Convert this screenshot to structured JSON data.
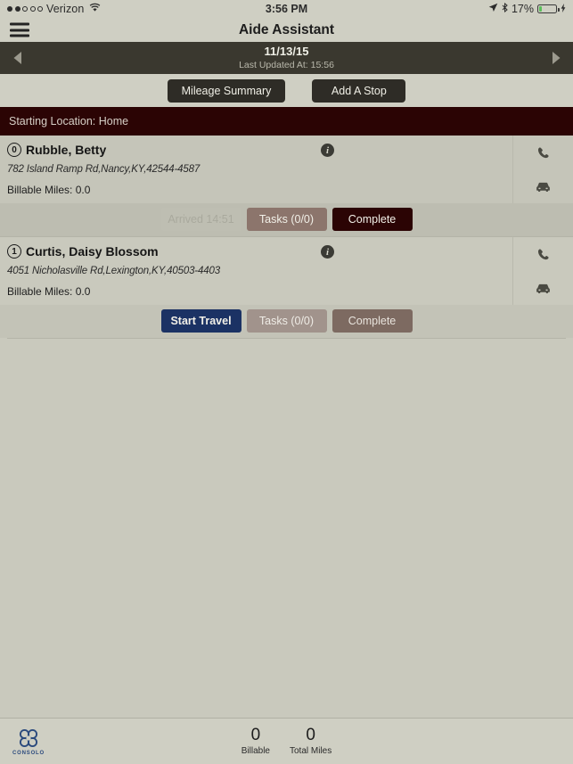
{
  "status_bar": {
    "carrier": "Verizon",
    "signal_filled": 2,
    "signal_total": 5,
    "wifi_icon": "wifi-icon",
    "time": "3:56 PM",
    "location_icon": "location-arrow-icon",
    "bluetooth_icon": "bluetooth-icon",
    "battery_percent": "17%",
    "battery_level": 17,
    "charging": true
  },
  "titlebar": {
    "menu_icon": "hamburger-menu-icon",
    "title": "Aide Assistant"
  },
  "datebar": {
    "prev_icon": "chevron-left-icon",
    "next_icon": "chevron-right-icon",
    "date": "11/13/15",
    "last_updated": "Last Updated At: 15:56"
  },
  "actions": {
    "mileage_summary": "Mileage Summary",
    "add_a_stop": "Add A Stop"
  },
  "starting_location": "Starting Location: Home",
  "visits": [
    {
      "badge": "0",
      "name": "Rubble, Betty",
      "address": "782 Island Ramp Rd,Nancy,KY,42544-4587",
      "billable_miles": "Billable Miles: 0.0",
      "info_icon": "info-icon",
      "phone_icon": "phone-icon",
      "car_icon": "car-icon",
      "buttons": {
        "primary": "Arrived 14:51",
        "primary_state": "disabled",
        "tasks": "Tasks (0/0)",
        "tasks_state": "active",
        "complete": "Complete",
        "complete_state": "active"
      }
    },
    {
      "badge": "1",
      "name": "Curtis, Daisy Blossom",
      "address": "4051 Nicholasville Rd,Lexington,KY,40503-4403",
      "billable_miles": "Billable Miles: 0.0",
      "info_icon": "info-icon",
      "phone_icon": "phone-icon",
      "car_icon": "car-icon",
      "buttons": {
        "primary": "Start Travel",
        "primary_state": "travel",
        "tasks": "Tasks (0/0)",
        "tasks_state": "dim",
        "complete": "Complete",
        "complete_state": "dim"
      }
    }
  ],
  "bottom_bar": {
    "logo_icon": "consolo-logo-icon",
    "logo_text": "CONSOLO",
    "stats": [
      {
        "value": "0",
        "label": "Billable"
      },
      {
        "value": "0",
        "label": "Total Miles"
      }
    ]
  },
  "colors": {
    "page_bg": "#c9c9bd",
    "chrome": "#cfcfc3",
    "dark_bar": "#3a382f",
    "maroon": "#2b0404",
    "navy": "#1b3264",
    "mauve": "#8c756c"
  }
}
